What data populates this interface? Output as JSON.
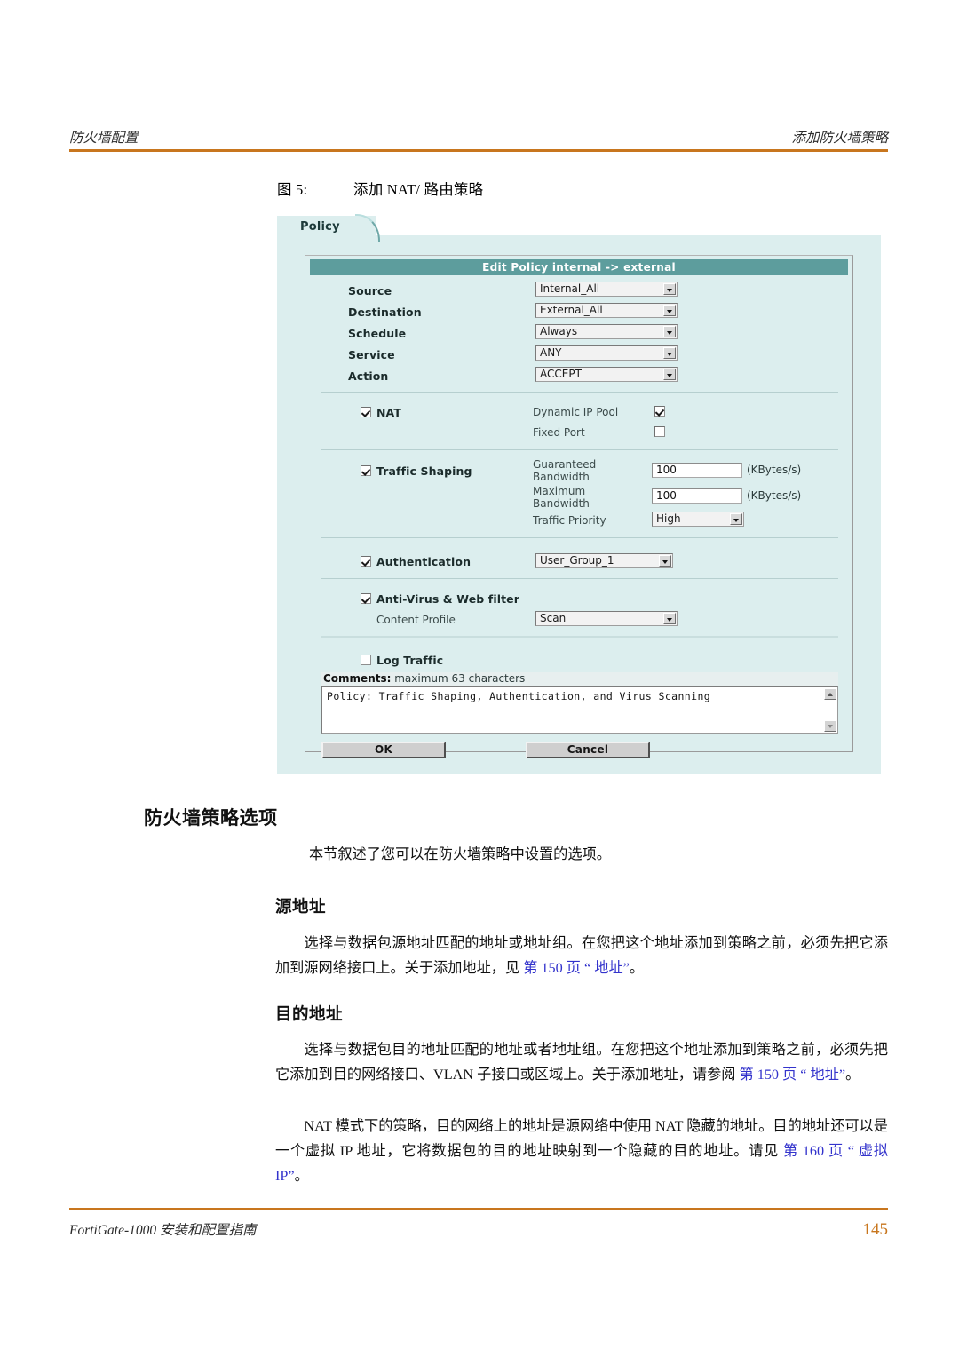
{
  "page": {
    "header_left": "防火墙配置",
    "header_right": "添加防火墙策略",
    "rule_color": "#C8761E",
    "footer_left": "FortiGate-1000 安装和配置指南",
    "page_number": "145"
  },
  "figure": {
    "label": "图 5:",
    "caption": "添加 NAT/ 路由策略"
  },
  "screenshot": {
    "tab_label": "Policy",
    "form_title": "Edit Policy internal -> external",
    "panel_bg": "#dceeee",
    "title_bar_color": "#5d9d9d",
    "fields": [
      {
        "label": "Source",
        "value": "Internal_All",
        "type": "select"
      },
      {
        "label": "Destination",
        "value": "External_All",
        "type": "select"
      },
      {
        "label": "Schedule",
        "value": "Always",
        "type": "select"
      },
      {
        "label": "Service",
        "value": "ANY",
        "type": "select"
      },
      {
        "label": "Action",
        "value": "ACCEPT",
        "type": "select"
      }
    ],
    "nat": {
      "label": "NAT",
      "checked": true,
      "options": [
        {
          "label": "Dynamic IP Pool",
          "checked": true
        },
        {
          "label": "Fixed Port",
          "checked": false
        }
      ]
    },
    "traffic_shaping": {
      "label": "Traffic Shaping",
      "checked": true,
      "guaranteed_label_line1": "Guaranteed",
      "guaranteed_label_line2": "Bandwidth",
      "guaranteed_value": "100",
      "guaranteed_unit": "(KBytes/s)",
      "maximum_label_line1": "Maximum",
      "maximum_label_line2": "Bandwidth",
      "maximum_value": "100",
      "maximum_unit": "(KBytes/s)",
      "priority_label": "Traffic Priority",
      "priority_value": "High"
    },
    "authentication": {
      "label": "Authentication",
      "checked": true,
      "group_value": "User_Group_1"
    },
    "antivirus": {
      "label": "Anti-Virus & Web filter",
      "checked": true,
      "content_profile_label": "Content Profile",
      "content_profile_value": "Scan"
    },
    "log_traffic": {
      "label": "Log Traffic",
      "checked": false
    },
    "comments": {
      "prefix": "Comments:",
      "hint": " maximum 63 characters",
      "value": "Policy: Traffic Shaping, Authentication, and Virus Scanning"
    },
    "buttons": {
      "ok": "OK",
      "cancel": "Cancel"
    }
  },
  "content": {
    "h1": "防火墙策略选项",
    "intro": "本节叙述了您可以在防火墙策略中设置的选项。",
    "source_heading": "源地址",
    "source_body_1": "选择与数据包源地址匹配的地址或地址组。在您把这个地址添加到策略之前，必须先把它添加到源网络接口上。关于添加地址，见",
    "source_link": "第 150 页 “ 地址”",
    "source_body_2": "。",
    "dest_heading": "目的地址",
    "dest_body_1": "选择与数据包目的地址匹配的地址或者地址组。在您把这个地址添加到策略之前，必须先把它添加到目的网络接口、VLAN 子接口或区域上。关于添加地址，请参阅",
    "dest_link": "第 150 页 “ 地址”",
    "dest_body_2": "。",
    "nat_body_1": "NAT 模式下的策略，目的网络上的地址是源网络中使用 NAT 隐藏的地址。目的地址还可以是一个虚拟 IP 地址，它将数据包的目的地址映射到一个隐藏的目的地址。请见",
    "nat_link": "第 160 页 “ 虚拟 IP”",
    "nat_body_2": "。"
  }
}
